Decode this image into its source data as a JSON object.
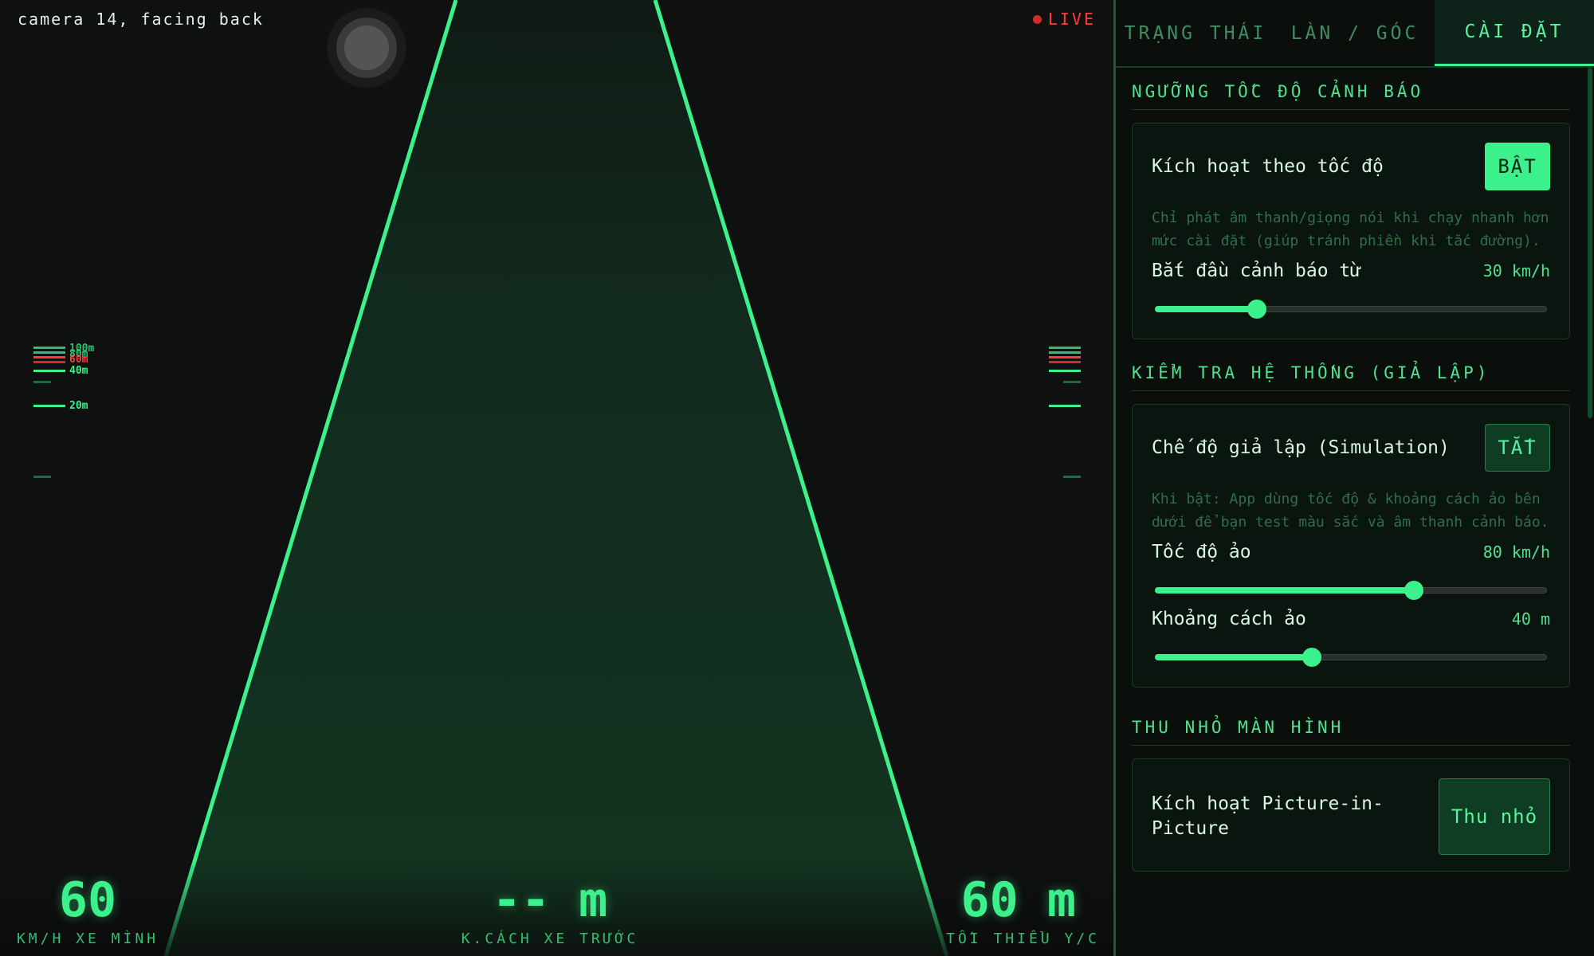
{
  "camera": {
    "label": "camera 14, facing back",
    "live": "LIVE",
    "scale_left": {
      "labels": [
        "100m",
        "80m",
        "60m",
        "40m",
        "20m"
      ]
    },
    "readouts": {
      "speed_value": "60",
      "speed_label": "KM/H XE MÌNH",
      "distance_value": "-- m",
      "distance_label": "K.CÁCH XE TRƯỚC",
      "min_value": "60 m",
      "min_label": "TỐI THIỂU Y/C"
    }
  },
  "panel": {
    "tabs": [
      {
        "label": "TRẠNG THÁI",
        "active": false
      },
      {
        "label": "LÀN / GÓC",
        "active": false
      },
      {
        "label": "CÀI ĐẶT",
        "active": true
      }
    ],
    "speed_threshold": {
      "title": "NGƯỠNG TỐC ĐỘ CẢNH BÁO",
      "toggle_label": "Kích hoạt theo tốc độ",
      "toggle_state": "BẬT",
      "description": "Chỉ phát âm thanh/giọng nói khi chạy nhanh hơn mức cài đặt (giúp tránh phiền khi tắc đường).",
      "start_label": "Bắt đầu cảnh báo từ",
      "start_value": "30 km/h",
      "start_fraction": 0.26
    },
    "system_check": {
      "title": "KIỂM TRA HỆ THỐNG (GIẢ LẬP)",
      "toggle_label": "Chế độ giả lập (Simulation)",
      "toggle_state": "TẮT",
      "description": "Khi bật: App dùng tốc độ & khoảng cách ảo bên dưới để bạn test màu sắc và âm thanh cảnh báo.",
      "speed_label": "Tốc độ ảo",
      "speed_value": "80 km/h",
      "speed_fraction": 0.66,
      "distance_label": "Khoảng cách ảo",
      "distance_value": "40 m",
      "distance_fraction": 0.4
    },
    "minimize": {
      "title": "THU NHỎ MÀN HÌNH",
      "toggle_label": "Kích hoạt Picture-in-Picture",
      "button_label": "Thu nhỏ"
    }
  },
  "colors": {
    "accent": "#3cf08c",
    "lane": "#3cf08c",
    "alert": "#ff3b3b",
    "panel_bg": "#0a0f0c"
  }
}
